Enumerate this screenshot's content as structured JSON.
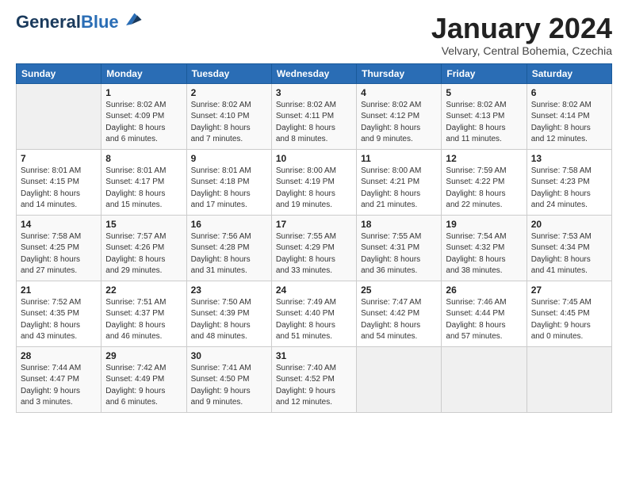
{
  "logo": {
    "line1": "General",
    "line2": "Blue"
  },
  "title": "January 2024",
  "subtitle": "Velvary, Central Bohemia, Czechia",
  "days_of_week": [
    "Sunday",
    "Monday",
    "Tuesday",
    "Wednesday",
    "Thursday",
    "Friday",
    "Saturday"
  ],
  "weeks": [
    [
      {
        "day": "",
        "info": ""
      },
      {
        "day": "1",
        "info": "Sunrise: 8:02 AM\nSunset: 4:09 PM\nDaylight: 8 hours\nand 6 minutes."
      },
      {
        "day": "2",
        "info": "Sunrise: 8:02 AM\nSunset: 4:10 PM\nDaylight: 8 hours\nand 7 minutes."
      },
      {
        "day": "3",
        "info": "Sunrise: 8:02 AM\nSunset: 4:11 PM\nDaylight: 8 hours\nand 8 minutes."
      },
      {
        "day": "4",
        "info": "Sunrise: 8:02 AM\nSunset: 4:12 PM\nDaylight: 8 hours\nand 9 minutes."
      },
      {
        "day": "5",
        "info": "Sunrise: 8:02 AM\nSunset: 4:13 PM\nDaylight: 8 hours\nand 11 minutes."
      },
      {
        "day": "6",
        "info": "Sunrise: 8:02 AM\nSunset: 4:14 PM\nDaylight: 8 hours\nand 12 minutes."
      }
    ],
    [
      {
        "day": "7",
        "info": "Sunrise: 8:01 AM\nSunset: 4:15 PM\nDaylight: 8 hours\nand 14 minutes."
      },
      {
        "day": "8",
        "info": "Sunrise: 8:01 AM\nSunset: 4:17 PM\nDaylight: 8 hours\nand 15 minutes."
      },
      {
        "day": "9",
        "info": "Sunrise: 8:01 AM\nSunset: 4:18 PM\nDaylight: 8 hours\nand 17 minutes."
      },
      {
        "day": "10",
        "info": "Sunrise: 8:00 AM\nSunset: 4:19 PM\nDaylight: 8 hours\nand 19 minutes."
      },
      {
        "day": "11",
        "info": "Sunrise: 8:00 AM\nSunset: 4:21 PM\nDaylight: 8 hours\nand 21 minutes."
      },
      {
        "day": "12",
        "info": "Sunrise: 7:59 AM\nSunset: 4:22 PM\nDaylight: 8 hours\nand 22 minutes."
      },
      {
        "day": "13",
        "info": "Sunrise: 7:58 AM\nSunset: 4:23 PM\nDaylight: 8 hours\nand 24 minutes."
      }
    ],
    [
      {
        "day": "14",
        "info": "Sunrise: 7:58 AM\nSunset: 4:25 PM\nDaylight: 8 hours\nand 27 minutes."
      },
      {
        "day": "15",
        "info": "Sunrise: 7:57 AM\nSunset: 4:26 PM\nDaylight: 8 hours\nand 29 minutes."
      },
      {
        "day": "16",
        "info": "Sunrise: 7:56 AM\nSunset: 4:28 PM\nDaylight: 8 hours\nand 31 minutes."
      },
      {
        "day": "17",
        "info": "Sunrise: 7:55 AM\nSunset: 4:29 PM\nDaylight: 8 hours\nand 33 minutes."
      },
      {
        "day": "18",
        "info": "Sunrise: 7:55 AM\nSunset: 4:31 PM\nDaylight: 8 hours\nand 36 minutes."
      },
      {
        "day": "19",
        "info": "Sunrise: 7:54 AM\nSunset: 4:32 PM\nDaylight: 8 hours\nand 38 minutes."
      },
      {
        "day": "20",
        "info": "Sunrise: 7:53 AM\nSunset: 4:34 PM\nDaylight: 8 hours\nand 41 minutes."
      }
    ],
    [
      {
        "day": "21",
        "info": "Sunrise: 7:52 AM\nSunset: 4:35 PM\nDaylight: 8 hours\nand 43 minutes."
      },
      {
        "day": "22",
        "info": "Sunrise: 7:51 AM\nSunset: 4:37 PM\nDaylight: 8 hours\nand 46 minutes."
      },
      {
        "day": "23",
        "info": "Sunrise: 7:50 AM\nSunset: 4:39 PM\nDaylight: 8 hours\nand 48 minutes."
      },
      {
        "day": "24",
        "info": "Sunrise: 7:49 AM\nSunset: 4:40 PM\nDaylight: 8 hours\nand 51 minutes."
      },
      {
        "day": "25",
        "info": "Sunrise: 7:47 AM\nSunset: 4:42 PM\nDaylight: 8 hours\nand 54 minutes."
      },
      {
        "day": "26",
        "info": "Sunrise: 7:46 AM\nSunset: 4:44 PM\nDaylight: 8 hours\nand 57 minutes."
      },
      {
        "day": "27",
        "info": "Sunrise: 7:45 AM\nSunset: 4:45 PM\nDaylight: 9 hours\nand 0 minutes."
      }
    ],
    [
      {
        "day": "28",
        "info": "Sunrise: 7:44 AM\nSunset: 4:47 PM\nDaylight: 9 hours\nand 3 minutes."
      },
      {
        "day": "29",
        "info": "Sunrise: 7:42 AM\nSunset: 4:49 PM\nDaylight: 9 hours\nand 6 minutes."
      },
      {
        "day": "30",
        "info": "Sunrise: 7:41 AM\nSunset: 4:50 PM\nDaylight: 9 hours\nand 9 minutes."
      },
      {
        "day": "31",
        "info": "Sunrise: 7:40 AM\nSunset: 4:52 PM\nDaylight: 9 hours\nand 12 minutes."
      },
      {
        "day": "",
        "info": ""
      },
      {
        "day": "",
        "info": ""
      },
      {
        "day": "",
        "info": ""
      }
    ]
  ]
}
